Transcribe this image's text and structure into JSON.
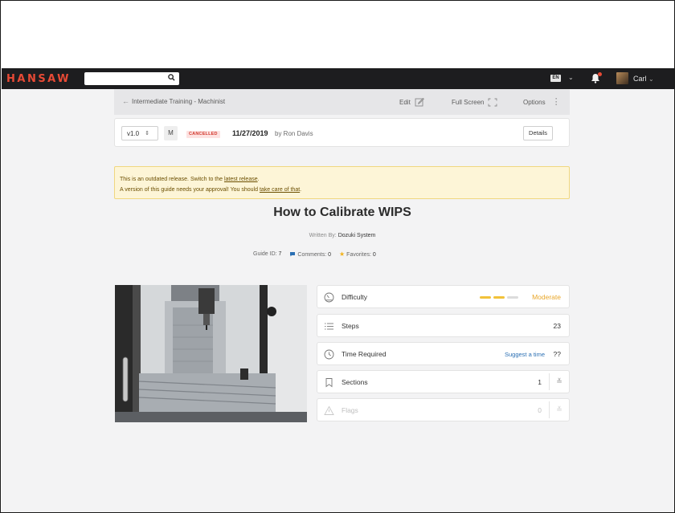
{
  "header": {
    "logo": "HANSAW",
    "language": "EN",
    "user_name": "Carl"
  },
  "breadcrumb": {
    "label": "Intermediate Training - Machinist",
    "edit_label": "Edit",
    "fullscreen_label": "Full Screen",
    "options_label": "Options"
  },
  "version": {
    "selected": "v1.0",
    "badge": "M",
    "status": "CANCELLED",
    "date": "11/27/2019",
    "author": "by Ron Davis",
    "details_label": "Details"
  },
  "notice": {
    "line1_prefix": "This is an outdated release. Switch to the ",
    "line1_link": "latest release",
    "line1_suffix": ".",
    "line2_prefix": "A version of this guide needs your approval! You should ",
    "line2_link": "take care of that",
    "line2_suffix": "."
  },
  "guide": {
    "title": "How to Calibrate WIPS",
    "written_by_label": "Written By:",
    "written_by": "Dozuki System",
    "guide_id_label": "Guide ID:",
    "guide_id": "7",
    "comments_label": "Comments:",
    "comments": "0",
    "favorites_label": "Favorites:",
    "favorites": "0"
  },
  "info": {
    "difficulty_label": "Difficulty",
    "difficulty_value": "Moderate",
    "difficulty_level": 2,
    "difficulty_max": 3,
    "steps_label": "Steps",
    "steps_value": "23",
    "time_label": "Time Required",
    "time_link": "Suggest a time",
    "time_value": "??",
    "sections_label": "Sections",
    "sections_value": "1",
    "flags_label": "Flags",
    "flags_value": "0"
  },
  "colors": {
    "brand": "#e84a35",
    "highlight_box": "#c0231b",
    "difficulty": "#e9a72a",
    "link": "#2a6fb3"
  }
}
